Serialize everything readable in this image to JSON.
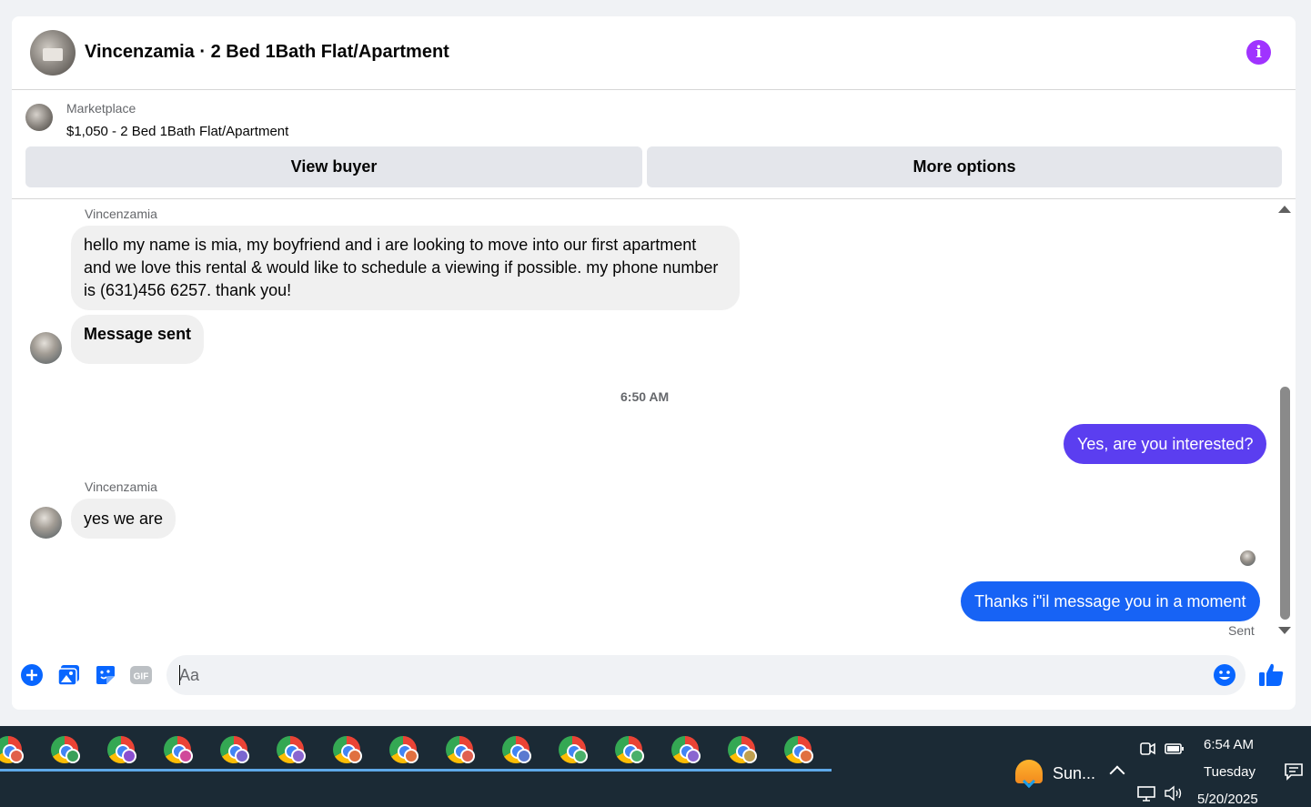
{
  "conversation": {
    "title": "Vincenzamia · 2 Bed 1Bath Flat/Apartment",
    "info_icon": "info-icon"
  },
  "listing": {
    "label": "Marketplace",
    "price_title": "$1,050 - 2 Bed 1Bath Flat/Apartment"
  },
  "actions": {
    "view_buyer": "View buyer",
    "more_options": "More options"
  },
  "messages": {
    "m1_sender": "Vincenzamia",
    "m1_text": "hello my name is mia, my boyfriend and i are looking to move into our first apartment and we love this rental & would like to schedule a viewing if possible. my phone number is (631)456 6257. thank you!",
    "m2_text": "Message sent",
    "time_divider": "6:50 AM",
    "m3_text": "Yes, are you interested?",
    "m4_sender": "Vincenzamia",
    "m4_text": "yes we are",
    "m5_text": "Thanks i\"il message you in a moment",
    "m5_status": "Sent"
  },
  "composer": {
    "placeholder": "Aa",
    "icons": [
      "plus-icon",
      "photo-icon",
      "sticker-icon",
      "gif-icon",
      "emoji-icon",
      "like-icon"
    ],
    "gif_label": "GIF"
  },
  "colors": {
    "outgoing_bubble": "#1763f5",
    "outgoing_bubble_first": "#5b3ef0",
    "accent": "#0866ff",
    "info": "#a033ff"
  },
  "taskbar": {
    "app_profile_colors": [
      "#e0604a",
      "#3aa05a",
      "#8a4fd0",
      "#d04a9a",
      "#7a66d0",
      "#8a66d0",
      "#e07040",
      "#e07040",
      "#e06050",
      "#5a7ad0",
      "#4ab06a",
      "#4ab06a",
      "#8a66d0",
      "#c0a050",
      "#e07040"
    ],
    "weather": "Sun...",
    "time": "6:54 AM",
    "day": "Tuesday",
    "date": "5/20/2025"
  }
}
